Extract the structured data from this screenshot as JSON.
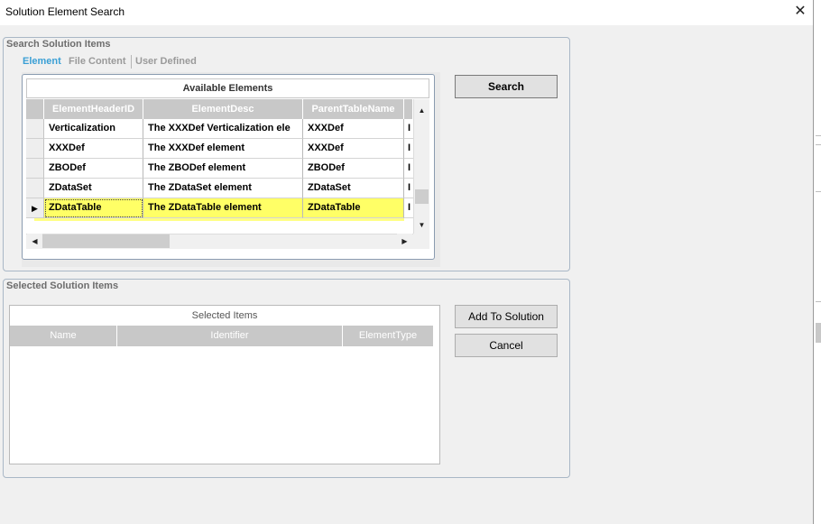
{
  "window": {
    "title": "Solution Element Search",
    "close_glyph": "✕"
  },
  "search_group": {
    "title": "Search Solution Items",
    "tabs": [
      {
        "label": "Element",
        "active": true
      },
      {
        "label": "File Content",
        "active": false
      },
      {
        "label": "User Defined",
        "active": false
      }
    ],
    "grid": {
      "caption": "Available Elements",
      "columns": [
        "ElementHeaderID",
        "ElementDesc",
        "ParentTableName",
        ""
      ],
      "rows": [
        {
          "cells": [
            "Verticalization",
            "The XXXDef Verticalization ele",
            "XXXDef",
            "I"
          ],
          "selected": false
        },
        {
          "cells": [
            "XXXDef",
            "The XXXDef element",
            "XXXDef",
            "I"
          ],
          "selected": false
        },
        {
          "cells": [
            "ZBODef",
            "The ZBODef element",
            "ZBODef",
            "I"
          ],
          "selected": false
        },
        {
          "cells": [
            "ZDataSet",
            "The ZDataSet element",
            "ZDataSet",
            "I"
          ],
          "selected": false
        },
        {
          "cells": [
            "ZDataTable",
            "The ZDataTable element",
            "ZDataTable",
            "I"
          ],
          "selected": true,
          "row_indicator": "▶"
        }
      ],
      "highlight_color": "#ffff66"
    },
    "search_button": "Search"
  },
  "selected_group": {
    "title": "Selected Solution Items",
    "grid": {
      "caption": "Selected Items",
      "columns": [
        "Name",
        "Identifier",
        "ElementType"
      ]
    },
    "add_button": "Add To Solution",
    "cancel_button": "Cancel"
  },
  "scroll_glyphs": {
    "up": "▲",
    "down": "▼",
    "left": "◀",
    "right": "▶"
  }
}
